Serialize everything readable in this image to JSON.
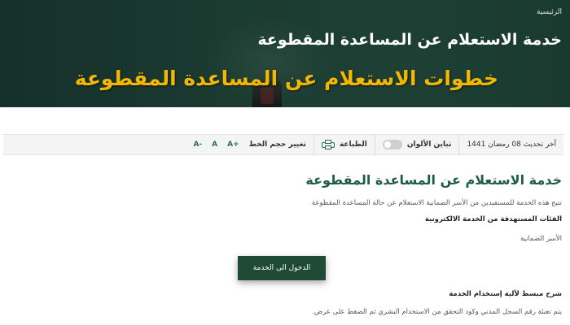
{
  "hero": {
    "breadcrumb": "الرئيسية",
    "title": "خدمة الاستعلام عن المساعدة المقطوعة",
    "overlay_caption": "خطوات الاستعلام عن المساعدة المقطوعة"
  },
  "toolbar": {
    "last_update": "آخر تحديث 08 رمضان 1441",
    "contrast_label": "تباين الألوان",
    "print_label": "الطباعة",
    "font_size_label": "تغيير حجم الخط",
    "font_increase": "A+",
    "font_reset": "A",
    "font_decrease": "A-"
  },
  "content": {
    "section_title": "خدمة الاستعلام عن المساعدة المقطوعة",
    "intro": "تتيح هذه الخدمة للمستفيدين من الأسر الضمانية الاستعلام عن حالة المساعدة المقطوعة",
    "target_heading": "الفئات المستهدفة من الخدمة الالكترونية",
    "target_value": "الأسر الضمانية",
    "enter_button": "الدخول الى الخدمة",
    "guide_heading": "شرح مبسط لآلية إستخدام الخدمة",
    "guide_text": "يتم تعبئة رقم السجل المدني وكود التحقق من الاستخدام البشري ثم الضغط على عرض."
  },
  "colors": {
    "hero_bg": "#1b3b31",
    "accent_green": "#1f5c44",
    "button_bg": "#1f4a36",
    "overlay_yellow": "#f2b705"
  }
}
